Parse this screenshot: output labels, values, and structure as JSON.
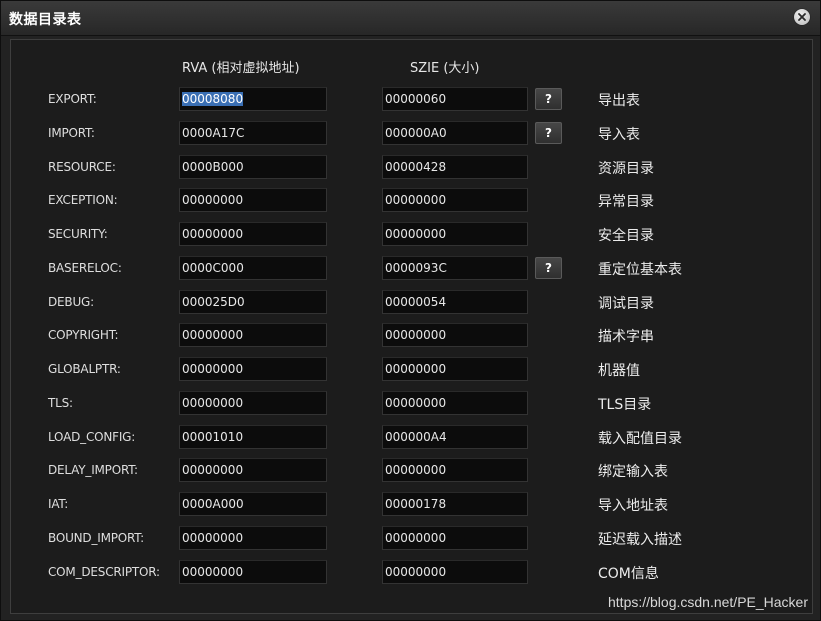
{
  "window": {
    "title": "数据目录表"
  },
  "columns": {
    "rva_header": "RVA (相对虚拟地址)",
    "size_header": "SZIE (大小)"
  },
  "rows": [
    {
      "name": "EXPORT:",
      "rva": "00008080",
      "size": "00000060",
      "has_button": true,
      "desc": "导出表",
      "rva_selected": true
    },
    {
      "name": "IMPORT:",
      "rva": "0000A17C",
      "size": "000000A0",
      "has_button": true,
      "desc": "导入表"
    },
    {
      "name": "RESOURCE:",
      "rva": "0000B000",
      "size": "00000428",
      "has_button": false,
      "desc": "资源目录"
    },
    {
      "name": "EXCEPTION:",
      "rva": "00000000",
      "size": "00000000",
      "has_button": false,
      "desc": "异常目录"
    },
    {
      "name": "SECURITY:",
      "rva": "00000000",
      "size": "00000000",
      "has_button": false,
      "desc": "安全目录"
    },
    {
      "name": "BASERELOC:",
      "rva": "0000C000",
      "size": "0000093C",
      "has_button": true,
      "desc": "重定位基本表"
    },
    {
      "name": "DEBUG:",
      "rva": "000025D0",
      "size": "00000054",
      "has_button": false,
      "desc": "调试目录"
    },
    {
      "name": "COPYRIGHT:",
      "rva": "00000000",
      "size": "00000000",
      "has_button": false,
      "desc": "描术字串"
    },
    {
      "name": "GLOBALPTR:",
      "rva": "00000000",
      "size": "00000000",
      "has_button": false,
      "desc": "机器值"
    },
    {
      "name": "TLS:",
      "rva": "00000000",
      "size": "00000000",
      "has_button": false,
      "desc": "TLS目录"
    },
    {
      "name": "LOAD_CONFIG:",
      "rva": "00001010",
      "size": "000000A4",
      "has_button": false,
      "desc": "载入配值目录"
    },
    {
      "name": "DELAY_IMPORT:",
      "rva": "00000000",
      "size": "00000000",
      "has_button": false,
      "desc": "绑定输入表"
    },
    {
      "name": "IAT:",
      "rva": "0000A000",
      "size": "00000178",
      "has_button": false,
      "desc": "导入地址表"
    },
    {
      "name": "BOUND_IMPORT:",
      "rva": "00000000",
      "size": "00000000",
      "has_button": false,
      "desc": "延迟载入描述"
    },
    {
      "name": "COM_DESCRIPTOR:",
      "rva": "00000000",
      "size": "00000000",
      "has_button": false,
      "desc": "COM信息"
    }
  ],
  "detail_button_label": "?",
  "icons": {
    "close": "close-icon"
  },
  "watermark": "https://blog.csdn.net/PE_Hacker",
  "colors": {
    "background": "#222222",
    "field": "#0c0c0c",
    "selection": "#3a6fb4",
    "text": "#e8e8e8"
  }
}
